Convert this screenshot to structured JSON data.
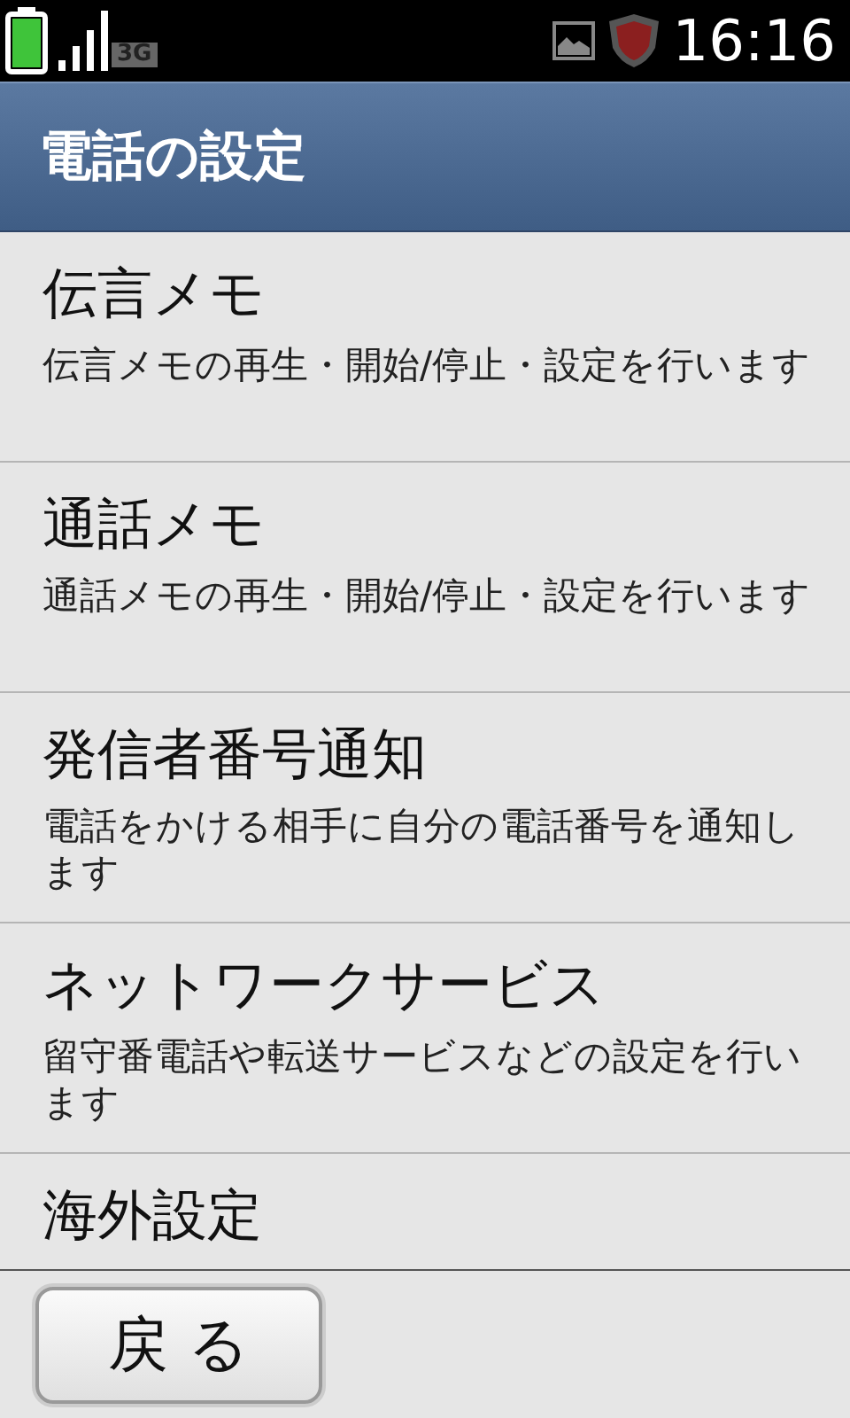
{
  "status_bar": {
    "network": "3G",
    "time": "16:16"
  },
  "title": "電話の設定",
  "items": [
    {
      "title": "伝言メモ",
      "summary": "伝言メモの再生・開始/停止・設定を行います"
    },
    {
      "title": "通話メモ",
      "summary": "通話メモの再生・開始/停止・設定を行います"
    },
    {
      "title": "発信者番号通知",
      "summary": "電話をかける相手に自分の電話番号を通知します"
    },
    {
      "title": "ネットワークサービス",
      "summary": "留守番電話や転送サービスなどの設定を行います"
    },
    {
      "title": "海外設定"
    }
  ],
  "back_button": "戻 る"
}
